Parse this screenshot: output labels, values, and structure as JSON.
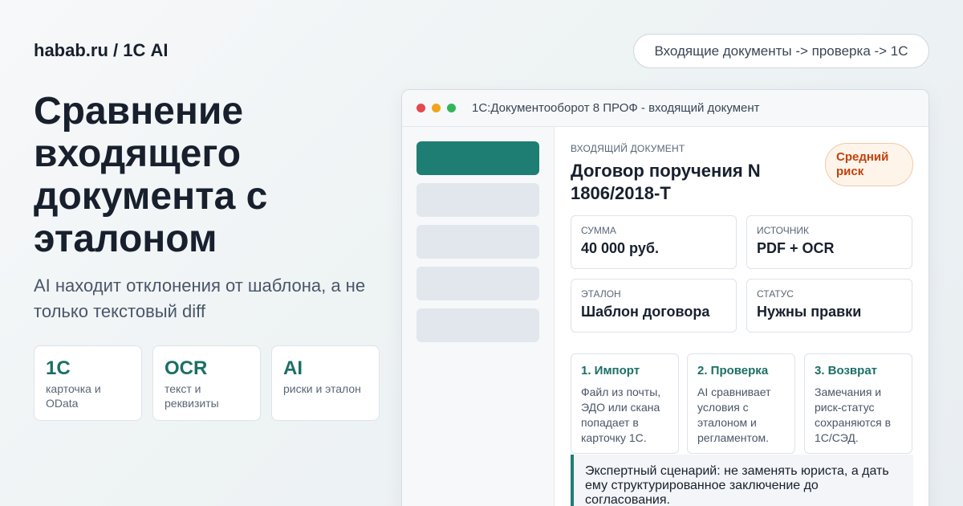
{
  "brand": "habab.ru / 1С AI",
  "flow_pill": "Входящие документы -> проверка -> 1С",
  "hero": {
    "title": "Сравнение входящего документа с эталоном",
    "subtitle": "AI находит отклонения от шаблона, а не только текстовый diff"
  },
  "features": [
    {
      "title": "1С",
      "text": "карточка и OData"
    },
    {
      "title": "OCR",
      "text": "текст и реквизиты"
    },
    {
      "title": "AI",
      "text": "риски и эталон"
    }
  ],
  "window": {
    "title": "1С:Документооборот 8 ПРОФ - входящий документ",
    "document": {
      "kicker": "ВХОДЯЩИЙ ДОКУМЕНТ",
      "title": "Договор поручения N 1806/2018-Т",
      "risk": "Средний риск"
    },
    "info": [
      {
        "label": "СУММА",
        "value": "40 000 руб."
      },
      {
        "label": "ИСТОЧНИК",
        "value": "PDF + OCR"
      },
      {
        "label": "ЭТАЛОН",
        "value": "Шаблон договора"
      },
      {
        "label": "СТАТУС",
        "value": "Нужны правки"
      }
    ],
    "steps": [
      {
        "title": "1. Импорт",
        "text": "Файл из почты, ЭДО или скана попадает в карточку 1С."
      },
      {
        "title": "2. Проверка",
        "text": "AI сравнивает условия с эталоном и регламентом."
      },
      {
        "title": "3. Возврат",
        "text": "Замечания и риск-статус сохраняются в 1С/СЭД."
      }
    ],
    "note": "Экспертный сценарий: не заменять юриста, а дать ему структурированное заключение до согласования."
  },
  "colors": {
    "accent": "#1f7e73",
    "accent_text": "#1b6f65",
    "risk": "#c2410c",
    "risk_bg": "#fff4ea",
    "window_dot_red": "#e5484d",
    "window_dot_yellow": "#f3a21b",
    "window_dot_green": "#33b55a"
  }
}
